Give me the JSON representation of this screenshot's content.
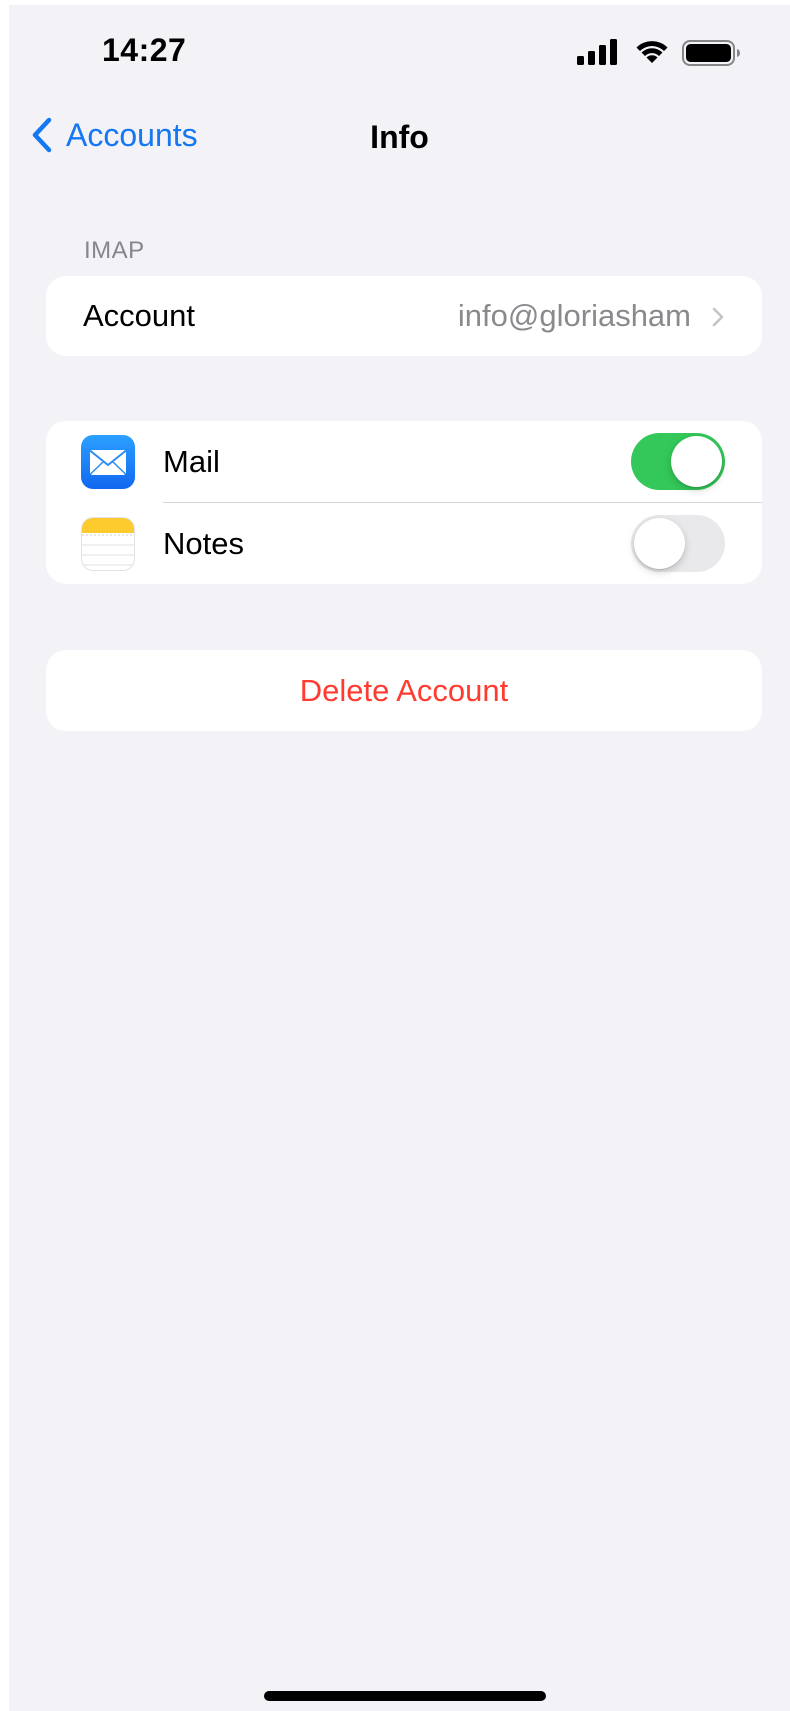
{
  "status_bar": {
    "time": "14:27",
    "icons": [
      "signal-icon",
      "wifi-icon",
      "battery-icon"
    ]
  },
  "nav": {
    "back_label": "Accounts",
    "title": "Info"
  },
  "section": {
    "header": "IMAP"
  },
  "account_row": {
    "label": "Account",
    "value": "info@gloriasham"
  },
  "toggles": [
    {
      "label": "Mail",
      "icon": "mail-icon",
      "enabled": true
    },
    {
      "label": "Notes",
      "icon": "notes-icon",
      "enabled": false
    }
  ],
  "delete": {
    "label": "Delete Account"
  },
  "colors": {
    "accent": "#1677f2",
    "toggle_on": "#34c759",
    "destructive": "#ff3b30",
    "background": "#f2f2f7"
  }
}
